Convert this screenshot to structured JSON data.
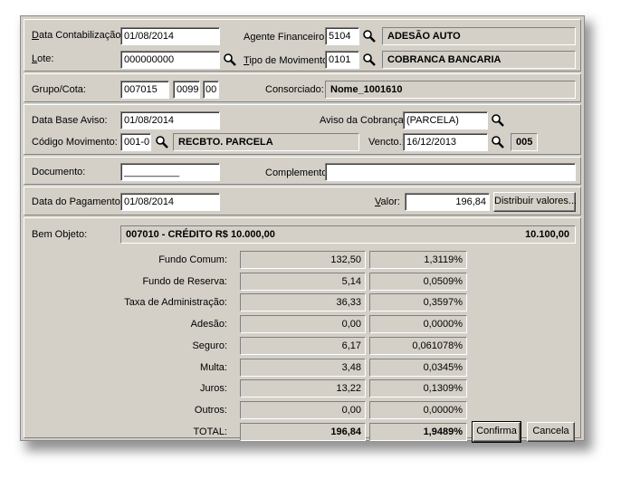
{
  "header": {
    "data_contabilizacao_label": "Data Contabilização:",
    "data_contabilizacao_value": "01/08/2014",
    "agente_financeiro_label": "Agente Financeiro:",
    "agente_financeiro_code": "5104",
    "agente_financeiro_name": "ADESÃO AUTO",
    "lote_label": "Lote:",
    "lote_value": "000000000",
    "tipo_movimento_label": "Tipo de Movimento:",
    "tipo_movimento_code": "0101",
    "tipo_movimento_name": "COBRANCA BANCARIA"
  },
  "grupo": {
    "grupo_cota_label": "Grupo/Cota:",
    "grupo": "007015",
    "cota": "0099",
    "digito": "00",
    "consorciado_label": "Consorciado:",
    "consorciado_value": "Nome_1001610"
  },
  "aviso": {
    "data_base_label": "Data Base Aviso:",
    "data_base_value": "01/08/2014",
    "aviso_cobranca_label": "Aviso da Cobrança:",
    "aviso_cobranca_value": "(PARCELA)",
    "codigo_movimento_label": "Código Movimento:",
    "codigo_movimento_code": "001-0",
    "codigo_movimento_name": "RECBTO. PARCELA",
    "vencto_label": "Vencto.:",
    "vencto_value": "16/12/2013",
    "vencto_extra": "005"
  },
  "documento": {
    "documento_label": "Documento:",
    "documento_value": "__________",
    "complemento_label": "Complemento:",
    "complemento_value": ""
  },
  "pagamento": {
    "data_pagamento_label": "Data do Pagamento:",
    "data_pagamento_value": "01/08/2014",
    "valor_label": "Valor:",
    "valor_value": "196,84",
    "distribuir_label": "Distribuir valores..."
  },
  "bem": {
    "label": "Bem Objeto:",
    "description": "007010 - CRÉDITO R$ 10.000,00",
    "value": "10.100,00"
  },
  "breakdown": [
    {
      "label": "Fundo Comum:",
      "value": "132,50",
      "percent": "1,3119%"
    },
    {
      "label": "Fundo de Reserva:",
      "value": "5,14",
      "percent": "0,0509%"
    },
    {
      "label": "Taxa de Administração:",
      "value": "36,33",
      "percent": "0,3597%"
    },
    {
      "label": "Adesão:",
      "value": "0,00",
      "percent": "0,0000%"
    },
    {
      "label": "Seguro:",
      "value": "6,17",
      "percent": "0,061078%"
    },
    {
      "label": "Multa:",
      "value": "3,48",
      "percent": "0,0345%"
    },
    {
      "label": "Juros:",
      "value": "13,22",
      "percent": "0,1309%"
    },
    {
      "label": "Outros:",
      "value": "0,00",
      "percent": "0,0000%"
    }
  ],
  "total": {
    "label": "TOTAL:",
    "value": "196,84",
    "percent": "1,9489%"
  },
  "actions": {
    "confirma_label": "Confirma",
    "cancela_label": "Cancela"
  }
}
